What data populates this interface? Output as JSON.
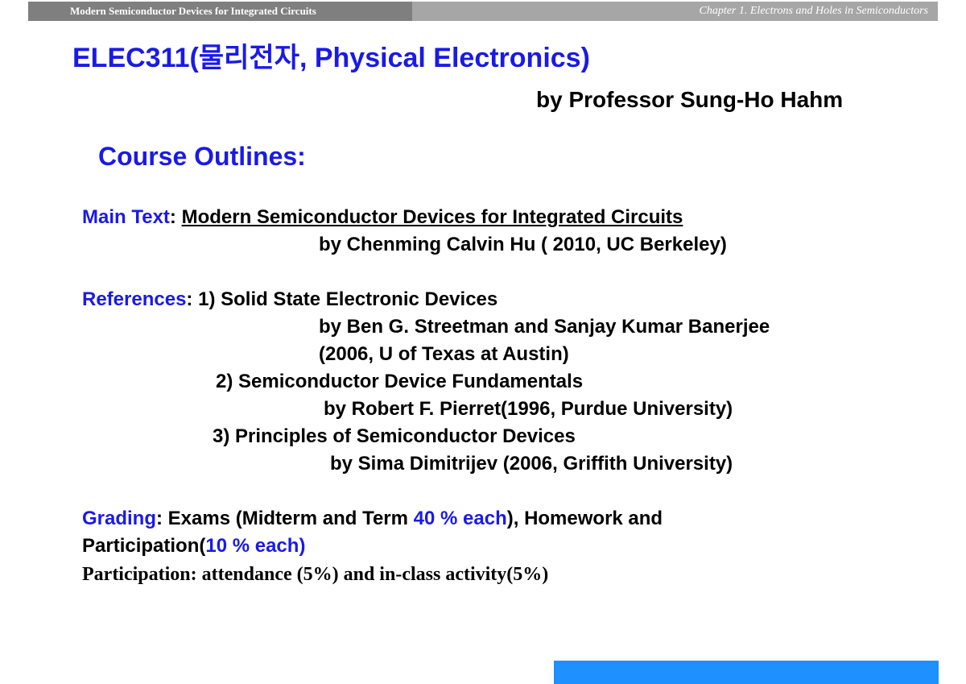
{
  "header": {
    "left_text": "Modern Semiconductor Devices for Integrated Circuits",
    "right_text": "Chapter 1.  Electrons and Holes in Semiconductors"
  },
  "title": "ELEC311(물리전자, Physical Electronics)",
  "professor": "by Professor Sung-Ho Hahm",
  "outline_heading": "Course Outlines:",
  "main_text": {
    "label": "Main Text",
    "colon": ":",
    "book": "Modern Semiconductor Devices for Integrated Circuits",
    "author": "by Chenming Calvin Hu ( 2010, UC Berkeley)"
  },
  "references": {
    "label": "References",
    "colon": ":",
    "items": [
      {
        "title": "1) Solid State Electronic Devices",
        "author": "by Ben G. Streetman and Sanjay Kumar Banerjee",
        "year": "(2006, U of Texas at Austin)"
      },
      {
        "title": "2) Semiconductor Device Fundamentals",
        "author": "by Robert F. Pierret(1996, Purdue University)"
      },
      {
        "title": "3) Principles of Semiconductor Devices",
        "author": "by Sima Dimitrijev (2006, Griffith University)"
      }
    ]
  },
  "grading": {
    "label": "Grading",
    "part1": ": Exams (Midterm and Term ",
    "exams_pct": "40 % each",
    "part2": "), Homework and",
    "part3": "Participation(",
    "hw_pct": "10 % each",
    "part4": ")",
    "participation_note": "Participation: attendance (5%) and in-class activity(5%)"
  },
  "colors": {
    "accent_blue": "#1a1ae6",
    "header_dark": "#7f7f7f",
    "header_light": "#a6a6a6",
    "footer_bar": "#1e90ff"
  }
}
